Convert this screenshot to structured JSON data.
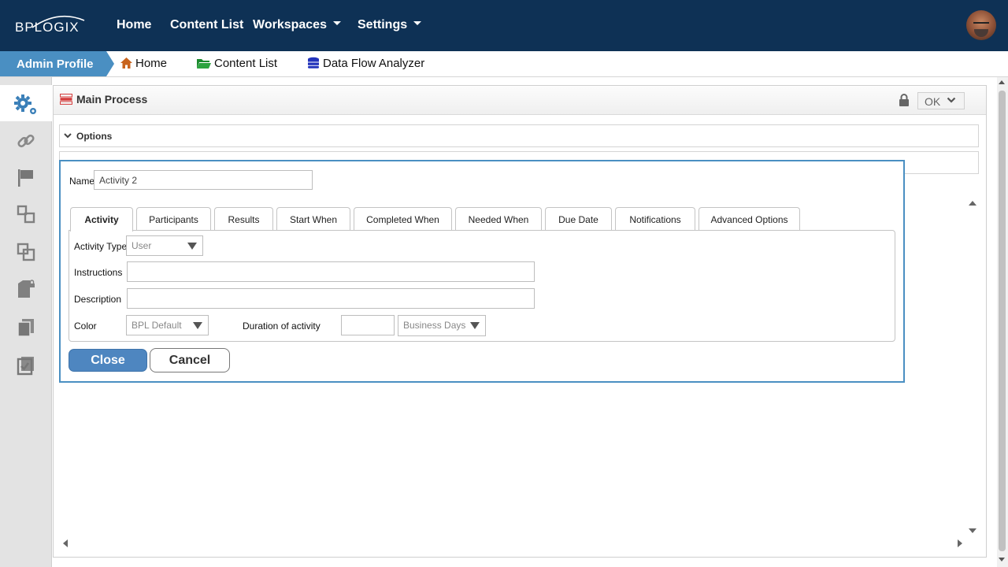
{
  "brand": {
    "logo": "BPLOGIX",
    "colors": {
      "topbar": "#0e3155",
      "accent": "#4a8fc2"
    }
  },
  "topnav": {
    "items": [
      {
        "label": "Home"
      },
      {
        "label": "Content List"
      },
      {
        "label": "Workspaces",
        "has_dropdown": true
      },
      {
        "label": "Settings",
        "has_dropdown": true
      }
    ]
  },
  "breadcrumb": {
    "active": "Admin Profile",
    "items": [
      {
        "label": "Home",
        "icon": "home-icon"
      },
      {
        "label": "Content List",
        "icon": "folder-icon"
      },
      {
        "label": "Data Flow Analyzer",
        "icon": "database-icon"
      }
    ]
  },
  "sidebar": {
    "icons": [
      "gears-icon",
      "link-icon",
      "flag-icon",
      "linked-squares-icon",
      "overlapping-squares-icon",
      "locked-document-icon",
      "copy-icon",
      "checklist-icon"
    ]
  },
  "process": {
    "title": "Main Process",
    "ok_label": "OK",
    "sections": [
      {
        "label": "Options"
      }
    ]
  },
  "dialog": {
    "name_label": "Name",
    "name_value": "Activity 2",
    "tabs": [
      "Activity",
      "Participants",
      "Results",
      "Start When",
      "Completed When",
      "Needed When",
      "Due Date",
      "Notifications",
      "Advanced Options"
    ],
    "active_tab": "Activity",
    "fields": {
      "activity_type_label": "Activity Type",
      "activity_type_value": "User",
      "instructions_label": "Instructions",
      "instructions_value": "",
      "description_label": "Description",
      "description_value": "",
      "color_label": "Color",
      "color_value": "BPL Default",
      "duration_label": "Duration of activity",
      "duration_value": "",
      "duration_unit": "Business Days"
    },
    "close_label": "Close",
    "cancel_label": "Cancel"
  }
}
